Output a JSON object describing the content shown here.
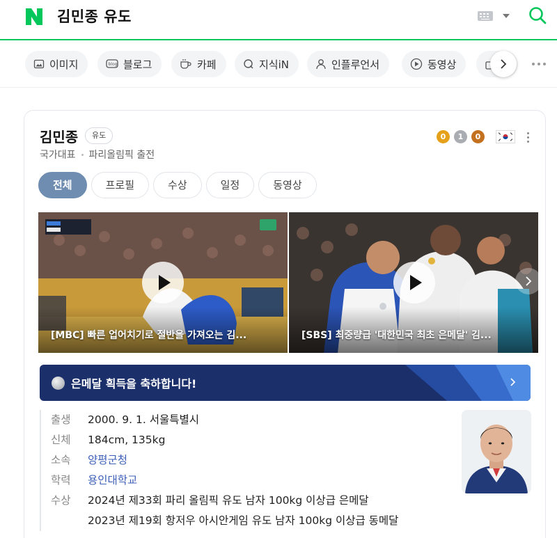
{
  "header": {
    "query": "김민종 유도",
    "logo_icon": "naver-n-logo",
    "search_icon": "search-icon",
    "brand_color": "#03c75a"
  },
  "tabs_bar": {
    "items": [
      {
        "label": "이미지",
        "icon": "image-icon"
      },
      {
        "label": "블로그",
        "icon": "blog-icon"
      },
      {
        "label": "카페",
        "icon": "cafe-icon"
      },
      {
        "label": "지식iN",
        "icon": "kin-icon"
      },
      {
        "label": "인플루언서",
        "icon": "person-icon"
      },
      {
        "label": "동영상",
        "icon": "play-circle-icon"
      }
    ]
  },
  "profile": {
    "name": "김민종",
    "sport": "유도",
    "sub_items": [
      "국가대표",
      "파리올림픽 출전"
    ],
    "medals": [
      {
        "count": "0",
        "color": "#e6a11a"
      },
      {
        "count": "1",
        "color": "#a9adb2"
      },
      {
        "count": "0",
        "color": "#c4711f"
      }
    ],
    "tabs": [
      "전체",
      "프로필",
      "수상",
      "일정",
      "동영상"
    ],
    "active_tab": 0
  },
  "videos": [
    {
      "caption": "[MBC] 빠른 업어치기로 절반을 가져오는 김..."
    },
    {
      "caption": "[SBS] 최중량급 '대한민국 최초 은메달' 김..."
    }
  ],
  "banner": {
    "text": "은메달 획득을 축하합니다!",
    "bg_color": "#1b2f6b"
  },
  "info": {
    "rows": [
      {
        "key": "출생",
        "value": "2000. 9. 1. 서울특별시",
        "link": false
      },
      {
        "key": "신체",
        "value": "184cm, 135kg",
        "link": false
      },
      {
        "key": "소속",
        "value": "양평군청",
        "link": true
      },
      {
        "key": "학력",
        "value": "용인대학교",
        "link": true
      },
      {
        "key": "수상",
        "value": "2024년 제33회 파리 올림픽 유도 남자 100kg 이상급 은메달",
        "link": false
      },
      {
        "key": "",
        "value": "2023년 제19회 항저우 아시안게임 유도 남자 100kg 이상급 동메달",
        "link": false
      }
    ]
  }
}
